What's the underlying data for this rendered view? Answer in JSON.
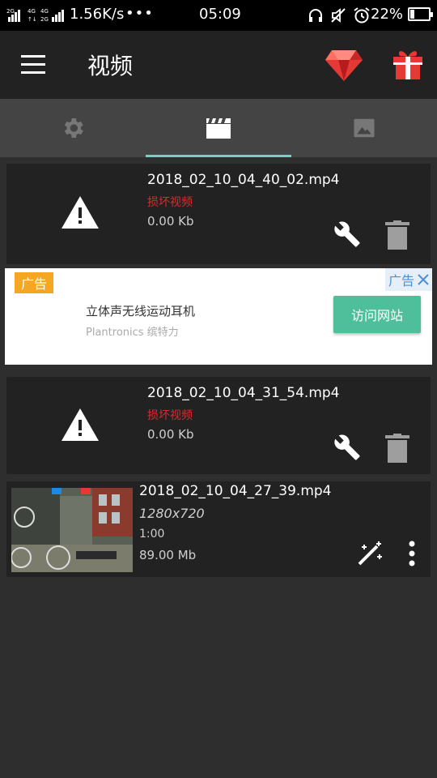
{
  "status_bar": {
    "net_speed": "1.56K/s",
    "dots": "•••",
    "time": "05:09",
    "battery_pct": "22%",
    "battery_level": 0.22
  },
  "app_bar": {
    "title": "视频",
    "icons": [
      "menu-icon",
      "gem-icon",
      "gift-icon"
    ]
  },
  "tabs": [
    {
      "icon": "gear-icon",
      "active": false
    },
    {
      "icon": "clapperboard-icon",
      "active": true
    },
    {
      "icon": "image-icon",
      "active": false
    }
  ],
  "items": [
    {
      "filename": "2018_02_10_04_40_02.mp4",
      "status": "损坏视频",
      "size": "0.00 Kb"
    },
    {
      "filename": "2018_02_10_04_31_54.mp4",
      "status": "损坏视频",
      "size": "0.00 Kb"
    },
    {
      "filename": "2018_02_10_04_27_39.mp4",
      "resolution": "1280x720",
      "duration": "1:00",
      "size": "89.00 Mb"
    }
  ],
  "ad": {
    "tag": "广告",
    "corner_label": "广告",
    "title": "立体声无线运动耳机",
    "subtitle": "Plantronics 缤特力",
    "button": "访问网站"
  },
  "colors": {
    "accent": "#80cbc4",
    "error": "#d32f2f",
    "ad_button": "#4fbe9a",
    "ad_tag": "#f5a623"
  }
}
